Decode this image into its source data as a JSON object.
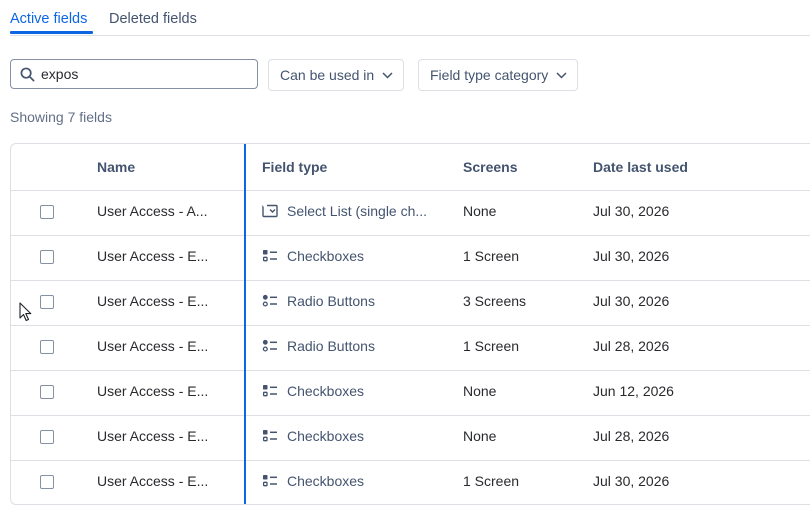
{
  "tabs": [
    {
      "label": "Active fields",
      "active": true
    },
    {
      "label": "Deleted fields",
      "active": false
    }
  ],
  "search": {
    "value": "expos",
    "icon": "search-icon"
  },
  "filters": {
    "can_be_used_in": "Can be used in",
    "field_type_category": "Field type category"
  },
  "showing_text": "Showing 7 fields",
  "table": {
    "columns": {
      "name": "Name",
      "field_type": "Field type",
      "screens": "Screens",
      "date_last_used": "Date last used"
    },
    "rows": [
      {
        "name": "User Access - A...",
        "field_type": "Select List (single ch...",
        "type_icon": "select-list-icon",
        "screens": "None",
        "date": "Jul 30, 2026"
      },
      {
        "name": "User Access - E...",
        "field_type": "Checkboxes",
        "type_icon": "checkboxes-icon",
        "screens": "1 Screen",
        "date": "Jul 30, 2026"
      },
      {
        "name": "User Access - E...",
        "field_type": "Radio Buttons",
        "type_icon": "radio-buttons-icon",
        "screens": "3 Screens",
        "date": "Jul 30, 2026"
      },
      {
        "name": "User Access - E...",
        "field_type": "Radio Buttons",
        "type_icon": "radio-buttons-icon",
        "screens": "1 Screen",
        "date": "Jul 28, 2026"
      },
      {
        "name": "User Access - E...",
        "field_type": "Checkboxes",
        "type_icon": "checkboxes-icon",
        "screens": "None",
        "date": "Jun 12, 2026"
      },
      {
        "name": "User Access - E...",
        "field_type": "Checkboxes",
        "type_icon": "checkboxes-icon",
        "screens": "None",
        "date": "Jul 28, 2026"
      },
      {
        "name": "User Access - E...",
        "field_type": "Checkboxes",
        "type_icon": "checkboxes-icon",
        "screens": "1 Screen",
        "date": "Jul 30, 2026"
      }
    ]
  },
  "colors": {
    "accent": "#0c66e4",
    "border": "#dcdfe4",
    "text": "#292a2e",
    "subtle_text": "#44546f"
  }
}
